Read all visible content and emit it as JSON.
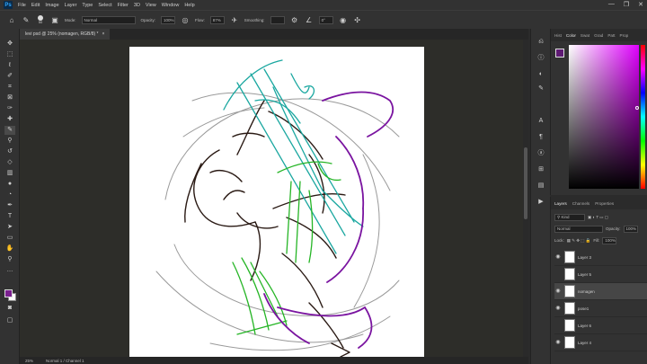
{
  "app": {
    "logo": "Ps",
    "menu": [
      "File",
      "Edit",
      "Image",
      "Layer",
      "Type",
      "Select",
      "Filter",
      "3D",
      "View",
      "Window",
      "Help"
    ],
    "window_controls": [
      "—",
      "❐",
      "✕"
    ]
  },
  "options_bar": {
    "brush_size": "50",
    "mode_label": "Mode:",
    "mode_value": "Normal",
    "opacity_label": "Opacity:",
    "opacity_value": "100%",
    "flow_label": "Flow:",
    "flow_value": "87%",
    "smoothing_label": "Smoothing:",
    "angle_value": "0°"
  },
  "document_tab": {
    "title": "levi psd @ 25% (nomagen, RGB/8) *",
    "close": "×"
  },
  "status_bar": {
    "zoom": "25%",
    "info": "Normal 1 / Channel 1"
  },
  "colors": {
    "foreground": "#7a1f8f",
    "background": "#ffffff",
    "sketch_dark": "#2a1a14",
    "sketch_teal": "#1aa7a0",
    "sketch_green": "#25b525",
    "sketch_purple": "#7a14a0",
    "sketch_gray": "#9a9a9a"
  },
  "color_panel": {
    "tabs": [
      "Hist",
      "Color",
      "Swat",
      "Grad",
      "Patt",
      "Prop"
    ],
    "active_tab": "Color"
  },
  "layers_panel": {
    "tabs": [
      "Layers",
      "Channels",
      "Properties"
    ],
    "active_tab": "Layers",
    "kind_label": "Kind",
    "blend_mode": "Normal",
    "opacity_label": "Opacity:",
    "opacity_value": "100%",
    "lock_label": "Lock:",
    "fill_label": "Fill:",
    "fill_value": "100%",
    "layers": [
      {
        "name": "Layer 3",
        "visible": true,
        "selected": false
      },
      {
        "name": "Layer 5",
        "visible": false,
        "selected": false
      },
      {
        "name": "nomagen",
        "visible": true,
        "selected": true
      },
      {
        "name": "pose1",
        "visible": true,
        "selected": false
      },
      {
        "name": "Layer 6",
        "visible": false,
        "selected": false
      },
      {
        "name": "Layer 4",
        "visible": true,
        "selected": false
      }
    ]
  },
  "icons": {
    "toolbar": [
      "move-icon",
      "marquee-icon",
      "lasso-icon",
      "quick-select-icon",
      "crop-icon",
      "frame-icon",
      "eyedropper-icon",
      "healing-icon",
      "brush-icon",
      "stamp-icon",
      "history-brush-icon",
      "eraser-icon",
      "gradient-icon",
      "blur-icon",
      "dodge-icon",
      "pen-icon",
      "type-icon",
      "path-select-icon",
      "shape-icon",
      "hand-icon",
      "zoom-icon",
      "more-icon"
    ],
    "strip": [
      "history-icon",
      "info-icon",
      "adjustments-icon",
      "brushes-icon",
      "character-icon",
      "paragraph-icon",
      "glyphs-icon",
      "styles-icon",
      "libraries-icon",
      "actions-icon"
    ]
  }
}
